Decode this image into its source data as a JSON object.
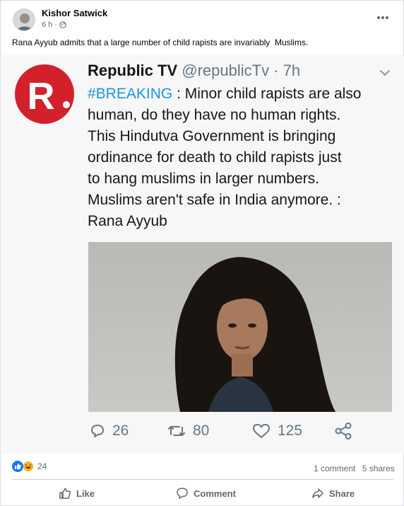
{
  "post": {
    "author": "Kishor Satwick",
    "time": "6 h",
    "separator": "·",
    "text": "Rana Ayyub admits that a large number of child rapists are invariably  Muslims."
  },
  "tweet": {
    "logo_letter": "R",
    "name": "Republic TV",
    "handle": "@republicTv · 7h",
    "hashtag": "#BREAKING",
    "line1_rest": " : Minor child rapists are also",
    "lines": [
      "human, do they have no human rights.",
      "This Hindutva Government is bringing",
      "ordinance for death to child rapists just",
      "to hang muslims in larger numbers.",
      "Muslims aren't safe in India anymore. :",
      "Rana Ayyub"
    ],
    "replies": "26",
    "retweets": "80",
    "likes": "125"
  },
  "footer": {
    "reaction_count": "24",
    "comments": "1 comment",
    "shares": "5 shares",
    "like_label": "Like",
    "comment_label": "Comment",
    "share_label": "Share"
  },
  "colors": {
    "republic_red": "#d3212c",
    "hashtag_blue": "#1b95e0",
    "facebook_blue": "#1877f2"
  }
}
